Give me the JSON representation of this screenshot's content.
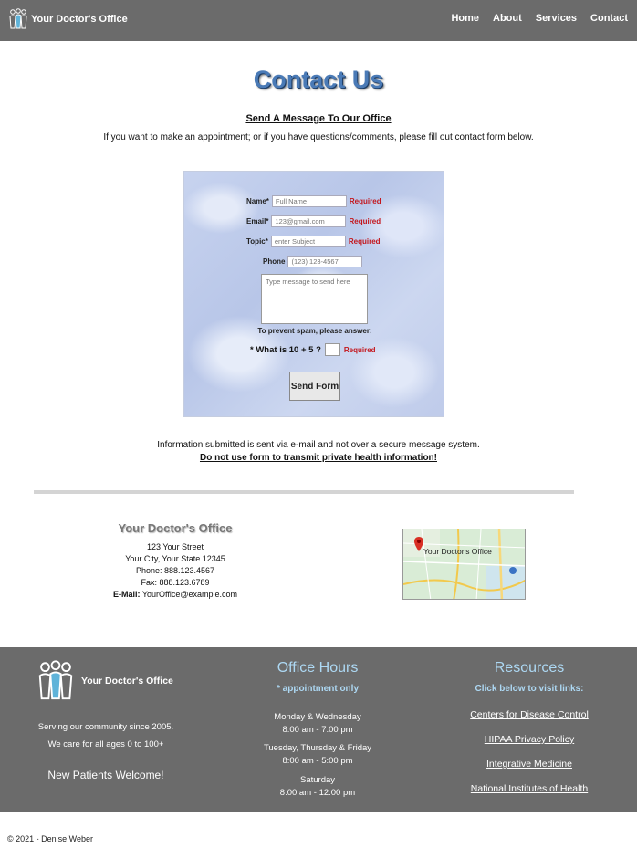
{
  "nav": {
    "brand": "Your Doctor's Office",
    "links": [
      "Home",
      "About",
      "Services",
      "Contact"
    ]
  },
  "header": {
    "title": "Contact Us",
    "subtitle": "Send A Message To Our Office",
    "intro": "If you want to make an appointment; or if you have questions/comments, please fill out contact form below."
  },
  "form": {
    "name_label": "Name*",
    "name_placeholder": "Full Name",
    "email_label": "Email*",
    "email_placeholder": "123@gmail.com",
    "topic_label": "Topic*",
    "topic_placeholder": "enter Subject",
    "phone_label": "Phone",
    "phone_placeholder": "(123) 123-4567",
    "message_placeholder": "Type message to send here",
    "required": "Required",
    "spam_text": "To prevent spam, please answer:",
    "quiz_question": "* What is 10 + 5 ?",
    "send_label": "Send Form"
  },
  "notice": {
    "line1": "Information submitted is sent via e-mail and not over a secure message system.",
    "line2": "Do not use form to transmit private health information!"
  },
  "address": {
    "name": "Your Doctor's Office",
    "street": "123 Your Street",
    "city": "Your City, Your State 12345",
    "phone": "Phone: 888.123.4567",
    "fax": "Fax: 888.123.6789",
    "email_label": "E-Mail:",
    "email": "YourOffice@example.com",
    "map_label": "Your Doctor's Office"
  },
  "footer": {
    "brand": "Your Doctor's Office",
    "serving": "Serving our community since 2005.",
    "ages": "We care for all ages 0 to 100+",
    "welcome": "New Patients Welcome!",
    "hours_title": "Office Hours",
    "hours_sub": "* appointment only",
    "hours": [
      {
        "days": "Monday & Wednesday",
        "time": "8:00 am - 7:00 pm"
      },
      {
        "days": "Tuesday, Thursday & Friday",
        "time": "8:00 am - 5:00 pm"
      },
      {
        "days": "Saturday",
        "time": "8:00 am - 12:00 pm"
      }
    ],
    "res_title": "Resources",
    "res_sub": "Click below to visit links:",
    "res_links": [
      "Centers for Disease Control",
      "HIPAA Privacy Policy",
      "Integrative Medicine",
      "National Institutes of Health"
    ]
  },
  "copyright": "© 2021 - Denise Weber",
  "colors": {
    "nav_bg": "#6b6b6b",
    "title_blue": "#4a7ab6",
    "required_red": "#c4161c",
    "footer_accent": "#add8f3"
  }
}
